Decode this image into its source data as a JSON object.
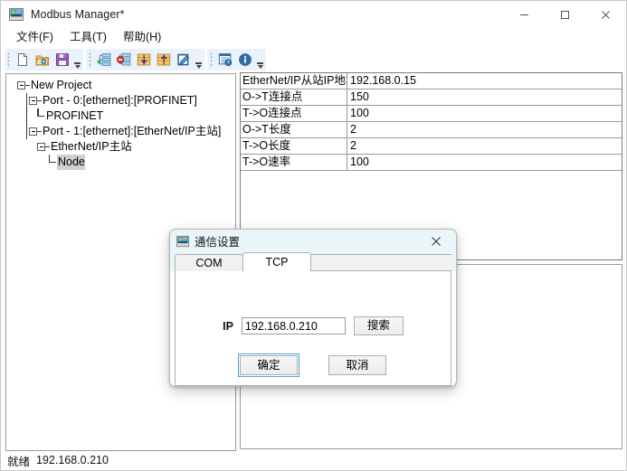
{
  "window": {
    "title": "Modbus Manager*",
    "icon": "app-icon",
    "controls": [
      {
        "name": "minimize",
        "glyph": "minimize-icon"
      },
      {
        "name": "maximize",
        "glyph": "maximize-icon"
      },
      {
        "name": "close",
        "glyph": "close-icon"
      }
    ]
  },
  "menubar": {
    "items": [
      {
        "label": "文件(F)",
        "name": "menu-file"
      },
      {
        "label": "工具(T)",
        "name": "menu-tools"
      },
      {
        "label": "帮助(H)",
        "name": "menu-help"
      }
    ]
  },
  "toolbar": {
    "groups": [
      {
        "name": "file-group",
        "buttons": [
          {
            "name": "new-file-icon"
          },
          {
            "name": "open-folder-icon"
          },
          {
            "name": "save-icon"
          }
        ]
      },
      {
        "name": "device-group",
        "buttons": [
          {
            "name": "add-node-icon"
          },
          {
            "name": "delete-node-icon"
          },
          {
            "name": "download-icon"
          },
          {
            "name": "upload-icon"
          },
          {
            "name": "edit-icon"
          }
        ]
      },
      {
        "name": "help-group",
        "buttons": [
          {
            "name": "diagnostics-icon"
          },
          {
            "name": "info-icon"
          }
        ]
      }
    ]
  },
  "tree": {
    "root": "New Project",
    "nodes": [
      {
        "label": "Port - 0:[ethernet]:[PROFINET]",
        "level": 1
      },
      {
        "label": "PROFINET",
        "level": 2
      },
      {
        "label": "Port - 1:[ethernet]:[EtherNet/IP主站]",
        "level": 1
      },
      {
        "label": "EtherNet/IP主站",
        "level": 2
      },
      {
        "label": "Node",
        "level": 3,
        "selected": true
      }
    ]
  },
  "properties": {
    "rows": [
      {
        "key": "EtherNet/IP从站IP地址",
        "value": "192.168.0.15"
      },
      {
        "key": "O->T连接点",
        "value": "150"
      },
      {
        "key": "T->O连接点",
        "value": "100"
      },
      {
        "key": "O->T长度",
        "value": "2"
      },
      {
        "key": "T->O长度",
        "value": "2"
      },
      {
        "key": "T->O速率",
        "value": "100"
      }
    ]
  },
  "dialog": {
    "title": "通信设置",
    "icon": "app-icon",
    "close_label": "close-icon",
    "tabs": [
      {
        "label": "COM",
        "name": "tab-com",
        "active": false
      },
      {
        "label": "TCP",
        "name": "tab-tcp",
        "active": true
      }
    ],
    "ip_label": "IP",
    "ip_value": "192.168.0.210",
    "ip_placeholder": "",
    "search_label": "搜索",
    "ok_label": "确定",
    "cancel_label": "取消"
  },
  "statusbar": {
    "state": "就绪",
    "ip": "192.168.0.210"
  },
  "colors": {
    "accent": "#4aa3df",
    "toolbar_group_bg": "#eaf3fb",
    "dialog_title_bg": "#eaf5fa",
    "selection": "#cfcfcf"
  }
}
